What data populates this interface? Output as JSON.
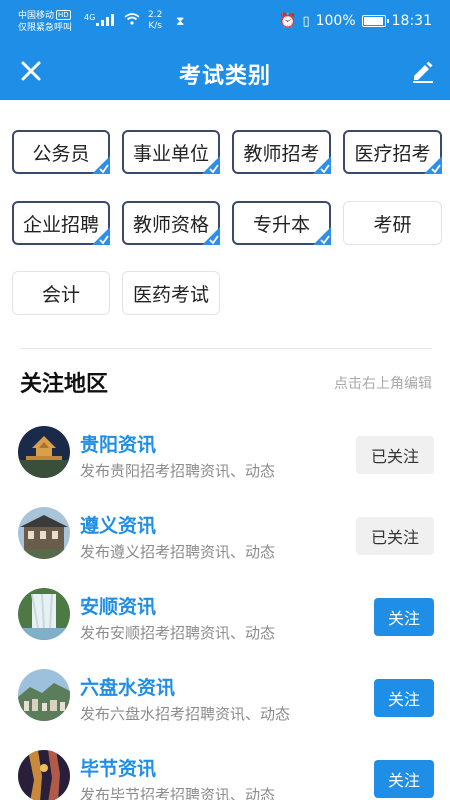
{
  "status_bar": {
    "carrier": "中国移动",
    "hd": "HD",
    "emergency": "仅限紧急呼叫",
    "signal": "4G",
    "speed_value": "2.2",
    "speed_unit": "K/s",
    "battery": "100%",
    "time": "18:31"
  },
  "header": {
    "title": "考试类别",
    "close_icon": "close-icon",
    "edit_icon": "edit-icon",
    "color": "#1e8ee6"
  },
  "categories": [
    {
      "label": "公务员",
      "selected": true
    },
    {
      "label": "事业单位",
      "selected": true
    },
    {
      "label": "教师招考",
      "selected": true
    },
    {
      "label": "医疗招考",
      "selected": true
    },
    {
      "label": "企业招聘",
      "selected": true
    },
    {
      "label": "教师资格",
      "selected": true
    },
    {
      "label": "专升本",
      "selected": true
    },
    {
      "label": "考研",
      "selected": false
    },
    {
      "label": "会计",
      "selected": false
    },
    {
      "label": "医药考试",
      "selected": false
    }
  ],
  "section": {
    "title": "关注地区",
    "hint": "点击右上角编辑"
  },
  "regions": [
    {
      "name": "贵阳资讯",
      "desc": "发布贵阳招考招聘资讯、动态",
      "button": "已关注",
      "followed": true
    },
    {
      "name": "遵义资讯",
      "desc": "发布遵义招考招聘资讯、动态",
      "button": "已关注",
      "followed": true
    },
    {
      "name": "安顺资讯",
      "desc": "发布安顺招考招聘资讯、动态",
      "button": "关注",
      "followed": false
    },
    {
      "name": "六盘水资讯",
      "desc": "发布六盘水招考招聘资讯、动态",
      "button": "关注",
      "followed": false
    },
    {
      "name": "毕节资讯",
      "desc": "发布毕节招考招聘资讯、动态",
      "button": "关注",
      "followed": false
    }
  ]
}
